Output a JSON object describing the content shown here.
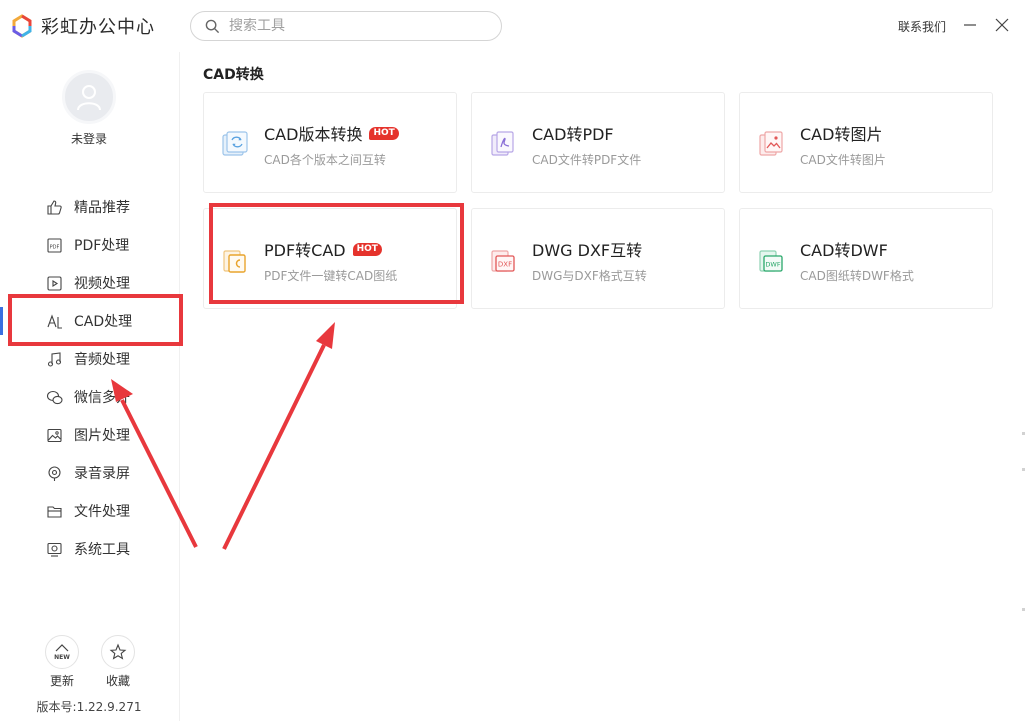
{
  "app": {
    "title": "彩虹办公中心"
  },
  "search": {
    "placeholder": "搜索工具"
  },
  "header": {
    "contact": "联系我们"
  },
  "user": {
    "status": "未登录"
  },
  "sidebar": {
    "items": [
      {
        "label": "精品推荐",
        "icon": "thumbs-up-icon"
      },
      {
        "label": "PDF处理",
        "icon": "pdf-icon"
      },
      {
        "label": "视频处理",
        "icon": "video-icon"
      },
      {
        "label": "CAD处理",
        "icon": "cad-icon",
        "active": true
      },
      {
        "label": "音频处理",
        "icon": "music-icon"
      },
      {
        "label": "微信多开",
        "icon": "wechat-icon"
      },
      {
        "label": "图片处理",
        "icon": "image-icon"
      },
      {
        "label": "录音录屏",
        "icon": "record-icon"
      },
      {
        "label": "文件处理",
        "icon": "folder-icon"
      },
      {
        "label": "系统工具",
        "icon": "system-icon"
      }
    ],
    "update_label": "更新",
    "update_badge": "NEW",
    "favorite_label": "收藏",
    "version": "版本号:1.22.9.271"
  },
  "main": {
    "section_title": "CAD转换",
    "cards": [
      {
        "title": "CAD版本转换",
        "desc": "CAD各个版本之间互转",
        "hot": true,
        "icon": "cad-version-icon"
      },
      {
        "title": "CAD转PDF",
        "desc": "CAD文件转PDF文件",
        "hot": false,
        "icon": "cad-to-pdf-icon"
      },
      {
        "title": "CAD转图片",
        "desc": "CAD文件转图片",
        "hot": false,
        "icon": "cad-to-image-icon"
      },
      {
        "title": "PDF转CAD",
        "desc": "PDF文件一键转CAD图纸",
        "hot": true,
        "icon": "pdf-to-cad-icon"
      },
      {
        "title": "DWG DXF互转",
        "desc": "DWG与DXF格式互转",
        "hot": false,
        "icon": "dwg-dxf-icon"
      },
      {
        "title": "CAD转DWF",
        "desc": "CAD图纸转DWF格式",
        "hot": false,
        "icon": "cad-to-dwf-icon"
      }
    ],
    "hot_label": "HOT"
  },
  "colors": {
    "accent": "#3b6fe0",
    "annotation": "#e8383d",
    "hot_badge": "#e5332c"
  }
}
